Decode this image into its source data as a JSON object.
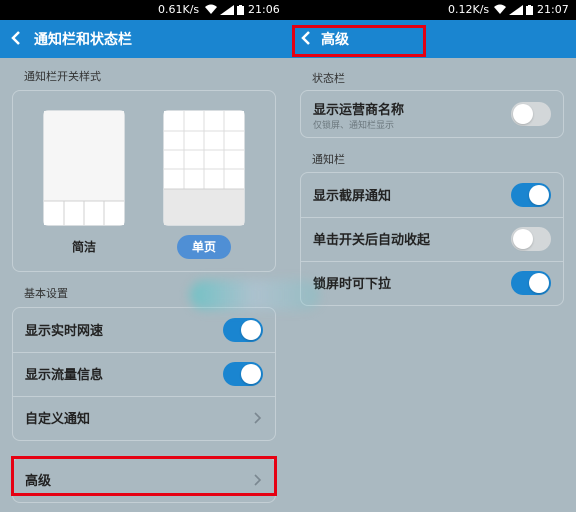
{
  "left": {
    "status": {
      "speed": "0.61K/s",
      "time": "21:06"
    },
    "title": "通知栏和状态栏",
    "switch_style_section": "通知栏开关样式",
    "styles": [
      {
        "label": "简洁",
        "selected": false
      },
      {
        "label": "单页",
        "selected": true
      }
    ],
    "basic_section": "基本设置",
    "basic_items": [
      {
        "label": "显示实时网速",
        "toggle": "on"
      },
      {
        "label": "显示流量信息",
        "toggle": "on"
      },
      {
        "label": "自定义通知"
      }
    ],
    "advanced_label": "高级"
  },
  "right": {
    "status": {
      "speed": "0.12K/s",
      "time": "21:07"
    },
    "title": "高级",
    "statusbar_section": "状态栏",
    "statusbar_item": {
      "label": "显示运营商名称",
      "sublabel": "仅锁屏、通知栏显示",
      "toggle": "off"
    },
    "notif_section": "通知栏",
    "notif_items": [
      {
        "label": "显示截屏通知",
        "toggle": "on"
      },
      {
        "label": "单击开关后自动收起",
        "toggle": "off"
      },
      {
        "label": "锁屏时可下拉",
        "toggle": "on"
      }
    ]
  },
  "colors": {
    "accent": "#1a85d0",
    "highlight": "#e60012",
    "background": "#aab9c1"
  }
}
